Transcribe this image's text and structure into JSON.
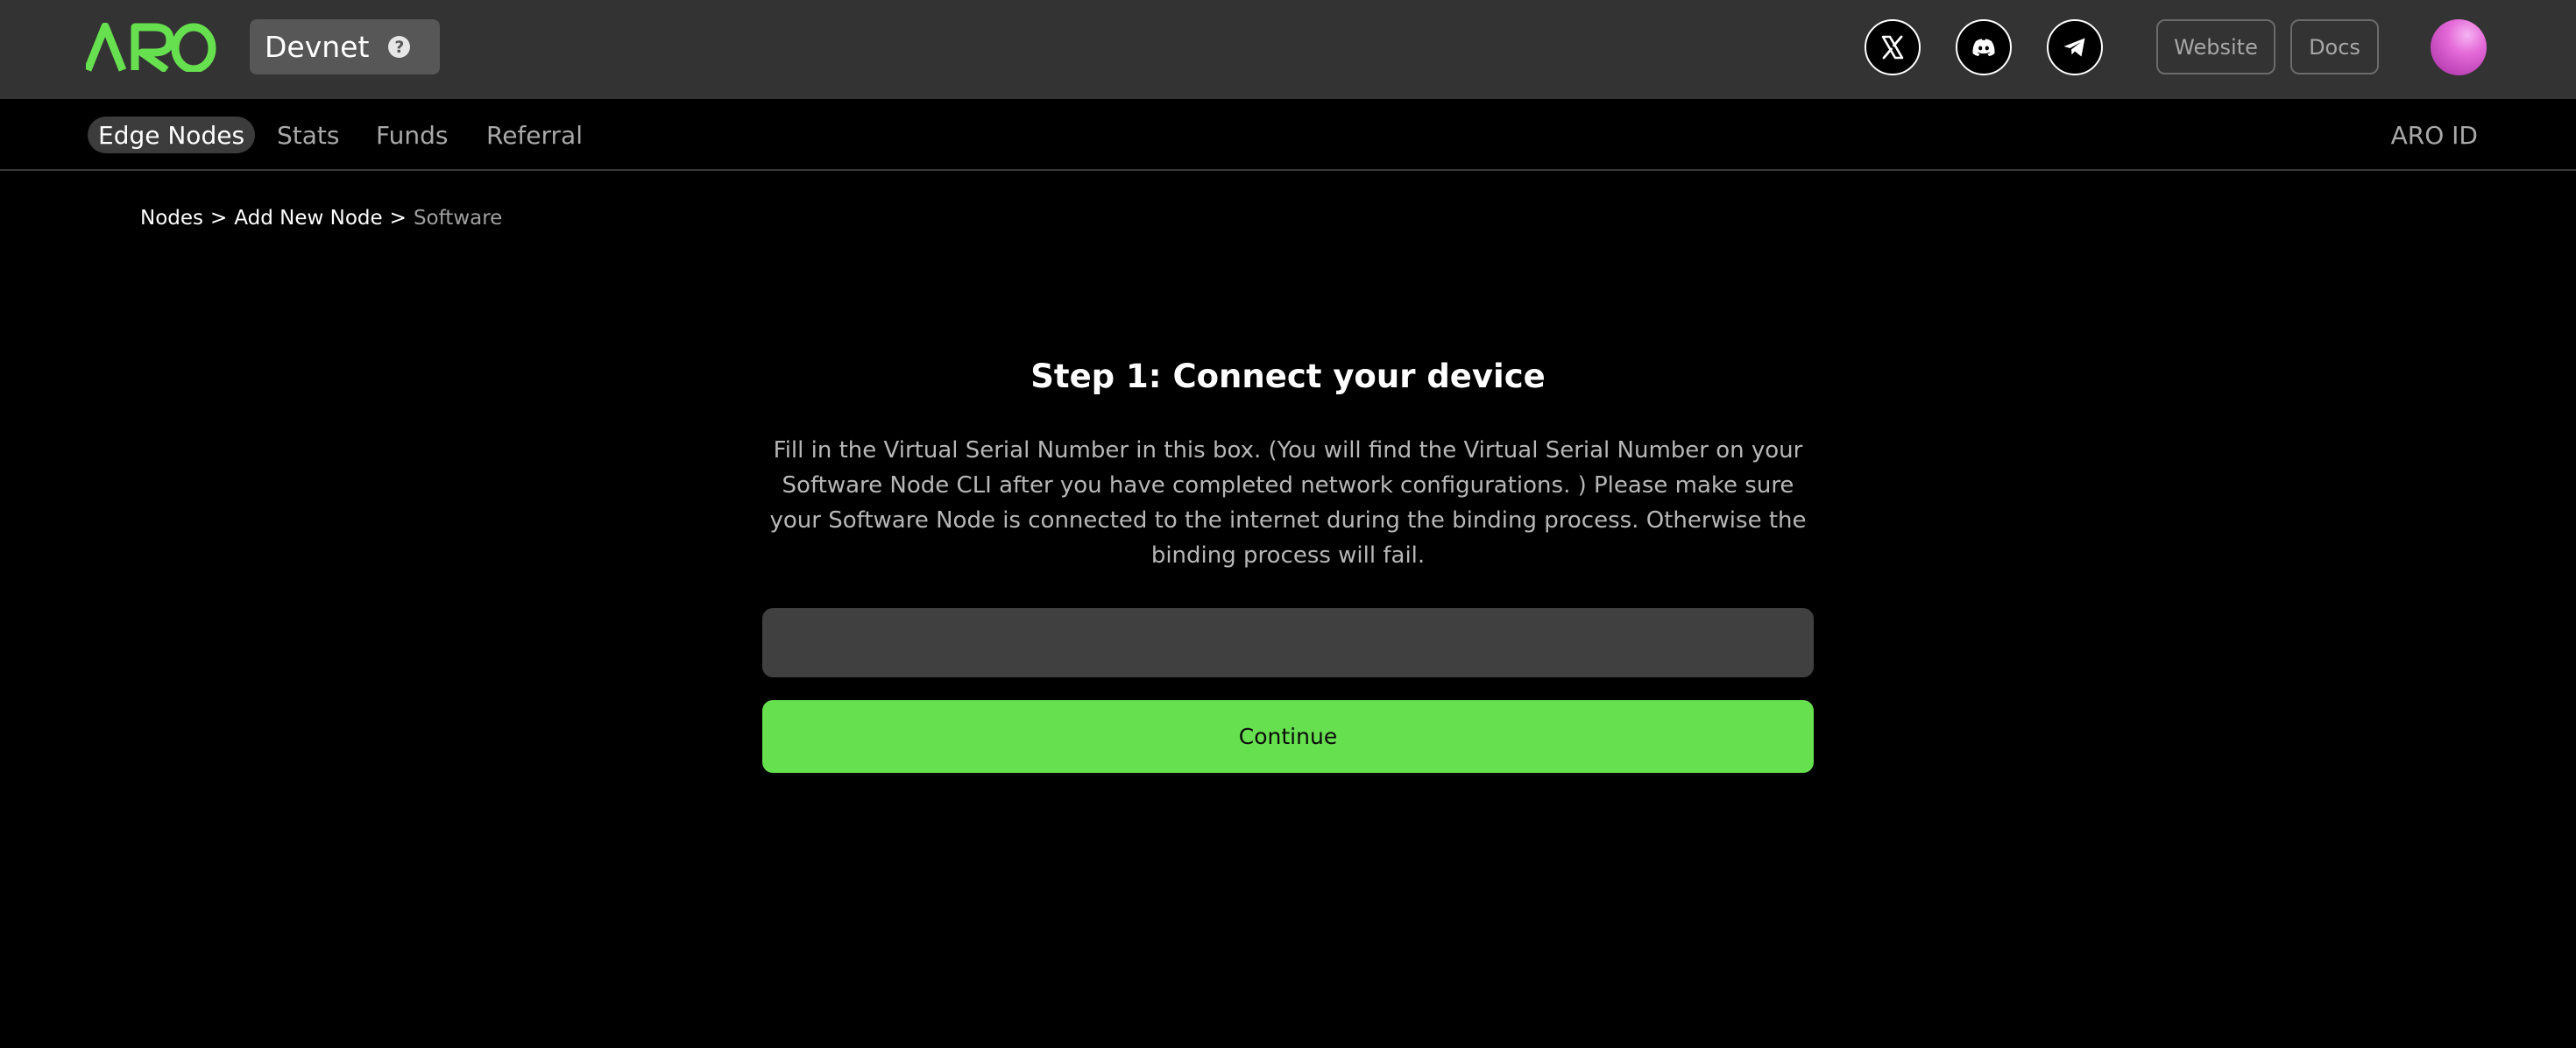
{
  "header": {
    "logo_text": "ARO",
    "network_label": "Devnet",
    "help_glyph": "?",
    "social": [
      {
        "icon": "x-twitter-icon"
      },
      {
        "icon": "discord-icon"
      },
      {
        "icon": "telegram-icon"
      }
    ],
    "website_label": "Website",
    "docs_label": "Docs",
    "accent_color": "#66e04e"
  },
  "nav": {
    "tabs": [
      {
        "label": "Edge Nodes",
        "active": true
      },
      {
        "label": "Stats"
      },
      {
        "label": "Funds"
      },
      {
        "label": "Referral"
      }
    ],
    "aro_id_label": "ARO ID"
  },
  "breadcrumb": {
    "items": [
      "Nodes",
      "Add New Node",
      "Software"
    ],
    "separator": ">"
  },
  "main": {
    "title": "Step 1: Connect your device",
    "instructions": "Fill in the Virtual Serial Number in this box. (You will find the Virtual Serial Number on your Software Node CLI after you have completed network configurations. ) Please make sure your Software Node is connected to the internet during the binding process. Otherwise the binding process will fail.",
    "serial_input_value": "",
    "continue_label": "Continue"
  }
}
